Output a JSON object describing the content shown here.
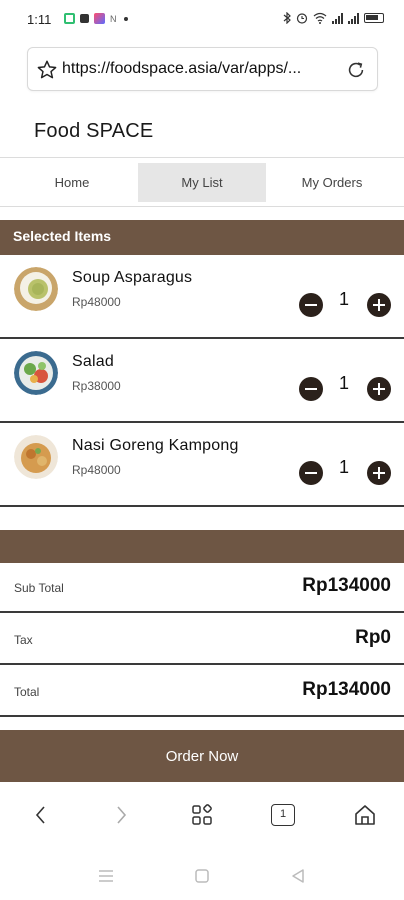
{
  "status_bar": {
    "time": "1:11",
    "notification_letter": "N",
    "right_icons": [
      "bluetooth-icon",
      "alarm-icon",
      "wifi-icon",
      "signal-icon",
      "signal-icon",
      "battery-icon"
    ]
  },
  "browser": {
    "url": "https://foodspace.asia/var/apps/...",
    "nav_icons": [
      "back-icon",
      "forward-icon",
      "apps-grid-icon",
      "tabs-icon",
      "home-icon"
    ],
    "tab_count": "1"
  },
  "app": {
    "title": "Food SPACE",
    "tabs": [
      {
        "label": "Home",
        "active": false
      },
      {
        "label": "My List",
        "active": true
      },
      {
        "label": "My Orders",
        "active": false
      }
    ],
    "selected_header": "Selected Items",
    "items": [
      {
        "name": "Soup Asparagus",
        "price": "Rp48000",
        "qty": "1"
      },
      {
        "name": "Salad",
        "price": "Rp38000",
        "qty": "1"
      },
      {
        "name": "Nasi Goreng Kampong",
        "price": "Rp48000",
        "qty": "1"
      }
    ],
    "summary": {
      "subtotal_label": "Sub Total",
      "subtotal_value": "Rp134000",
      "tax_label": "Tax",
      "tax_value": "Rp0",
      "total_label": "Total",
      "total_value": "Rp134000"
    },
    "order_button": "Order Now"
  },
  "colors": {
    "brand_brown": "#6e5644",
    "qty_button": "#2b211b",
    "active_tab_bg": "#e6e6e6"
  }
}
